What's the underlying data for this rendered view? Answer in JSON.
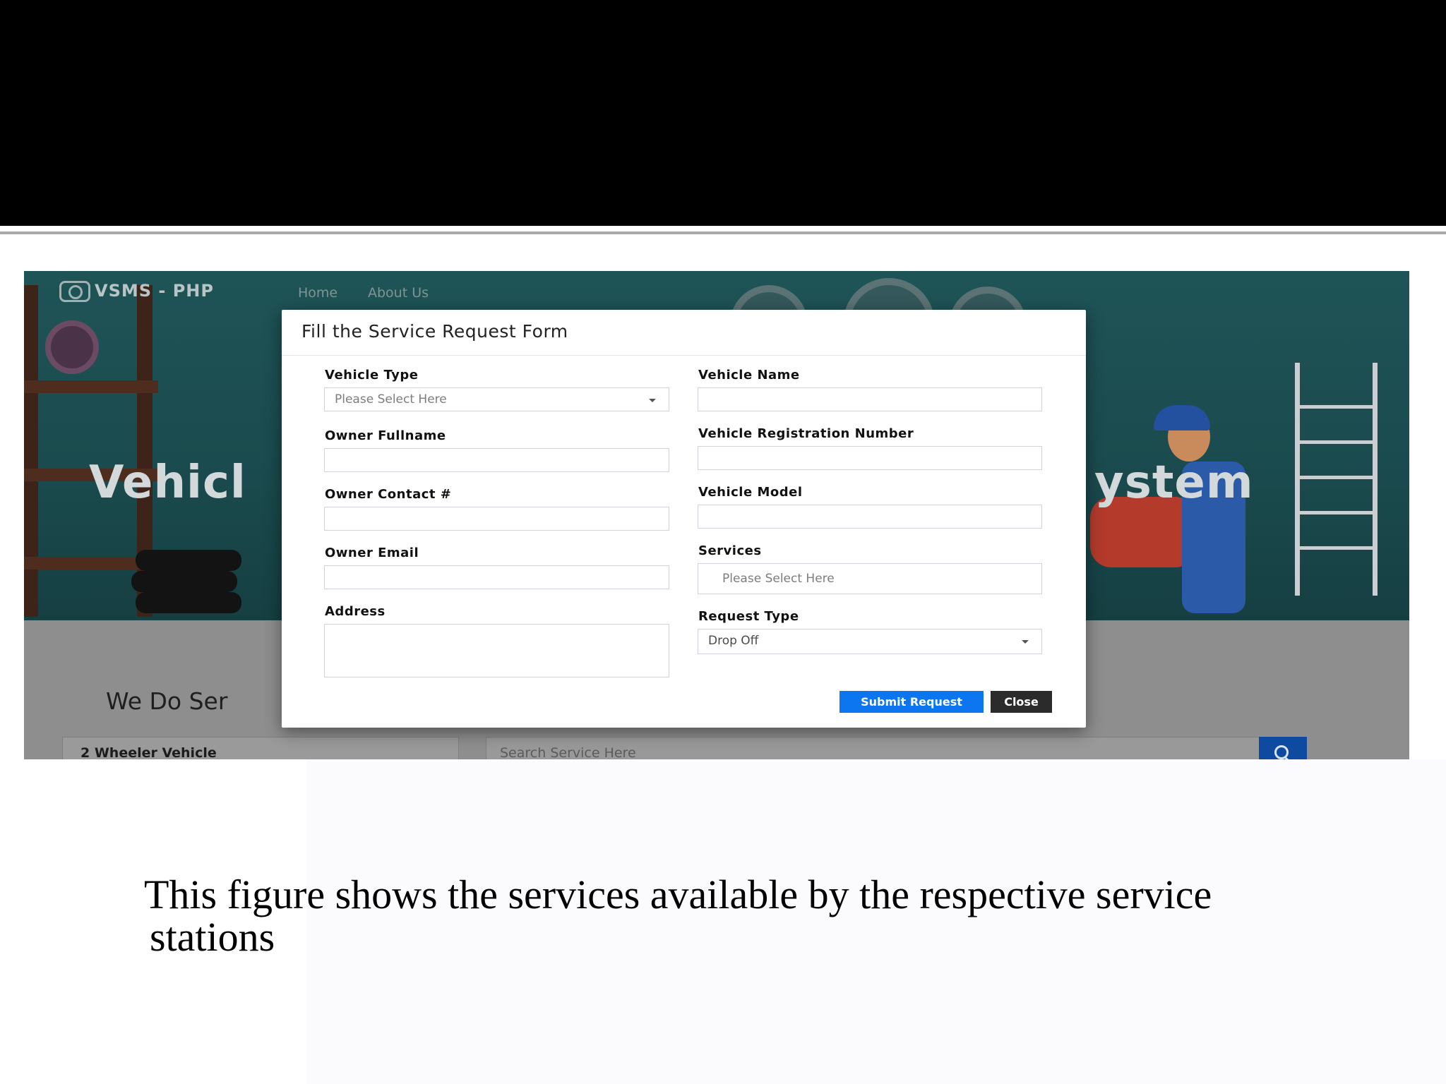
{
  "app": {
    "brand": "VSMS - PHP",
    "nav": [
      "Home",
      "About Us"
    ]
  },
  "hero": {
    "title_left": "Vehicl",
    "title_right": "ystem"
  },
  "page": {
    "heading": "We Do Ser",
    "category": "2 Wheeler Vehicle",
    "search_placeholder": "Search Service Here"
  },
  "modal": {
    "title": "Fill the Service Request Form",
    "fields": {
      "vehicle_type": {
        "label": "Vehicle Type",
        "value": "Please Select Here"
      },
      "vehicle_name": {
        "label": "Vehicle Name",
        "value": ""
      },
      "owner_fullname": {
        "label": "Owner Fullname",
        "value": ""
      },
      "vehicle_registration_number": {
        "label": "Vehicle Registration Number",
        "value": ""
      },
      "owner_contact": {
        "label": "Owner Contact #",
        "value": ""
      },
      "vehicle_model": {
        "label": "Vehicle Model",
        "value": ""
      },
      "owner_email": {
        "label": "Owner Email",
        "value": ""
      },
      "services": {
        "label": "Services",
        "value": "Please Select Here"
      },
      "address": {
        "label": "Address",
        "value": ""
      },
      "request_type": {
        "label": "Request Type",
        "value": "Drop Off"
      }
    },
    "buttons": {
      "submit": "Submit Request",
      "close": "Close"
    }
  },
  "caption": {
    "line1": "This figure shows the services available by the respective service",
    "line2": "stations"
  },
  "colors": {
    "submit_button": "#0b76f0",
    "close_button": "#2b2b2b",
    "hero_background": "#1f5457",
    "search_button": "#0d4aa0"
  },
  "icons": [
    "search-icon",
    "chevron-down-icon",
    "brand-logo-icon"
  ]
}
